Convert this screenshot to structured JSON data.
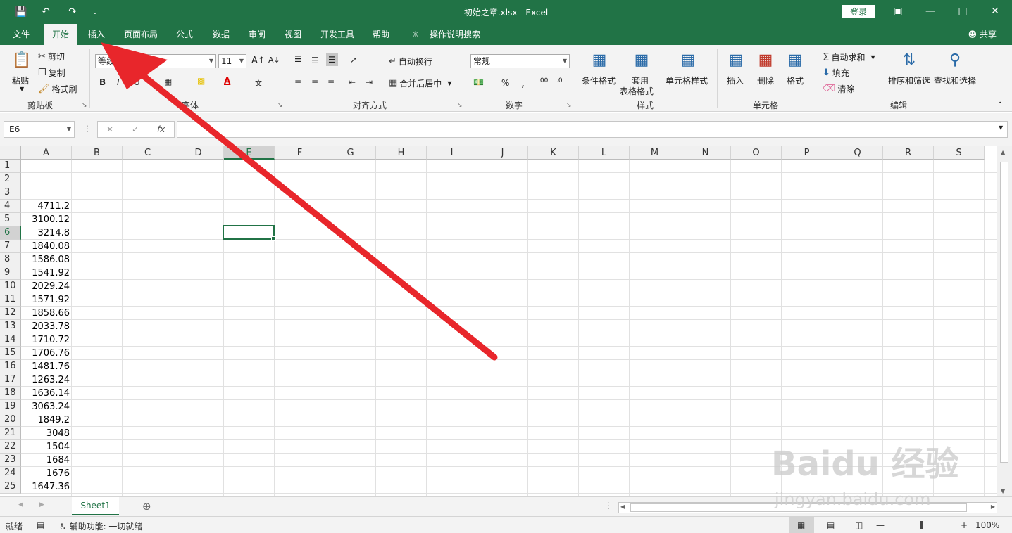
{
  "window": {
    "doc_title": "初始之章.xlsx  -  Excel",
    "login_label": "登录"
  },
  "tabs": [
    "文件",
    "开始",
    "插入",
    "页面布局",
    "公式",
    "数据",
    "审阅",
    "视图",
    "开发工具",
    "帮助",
    "操作说明搜索"
  ],
  "share_label": "共享",
  "ribbon": {
    "clipboard": {
      "paste": "粘贴",
      "cut": "剪切",
      "copy": "复制",
      "format_painter": "格式刷",
      "label": "剪贴板"
    },
    "font": {
      "name": "等线",
      "size": "11",
      "label": "字体",
      "bold": "B",
      "italic": "I",
      "underline": "U"
    },
    "alignment": {
      "wrap": "自动换行",
      "merge": "合并后居中",
      "label": "对齐方式"
    },
    "number": {
      "format": "常规",
      "percent": "%",
      "comma": ",",
      "label": "数字"
    },
    "styles": {
      "conditional": "条件格式",
      "table1": "套用",
      "table2": "表格格式",
      "cell_styles": "单元格样式",
      "label": "样式"
    },
    "cells": {
      "insert": "插入",
      "delete": "删除",
      "format": "格式",
      "label": "单元格"
    },
    "editing": {
      "autosum": "自动求和",
      "fill": "填充",
      "clear": "清除",
      "sort": "排序和筛选",
      "find": "查找和选择",
      "label": "编辑"
    }
  },
  "formula_bar": {
    "name_box": "E6",
    "fx": "fx",
    "value": ""
  },
  "columns": [
    "A",
    "B",
    "C",
    "D",
    "E",
    "F",
    "G",
    "H",
    "I",
    "J",
    "K",
    "L",
    "M",
    "N",
    "O",
    "P",
    "Q",
    "R",
    "S"
  ],
  "selected_column": "E",
  "selected_row": 6,
  "rows": [
    {
      "n": "1",
      "a": ""
    },
    {
      "n": "2",
      "a": ""
    },
    {
      "n": "3",
      "a": ""
    },
    {
      "n": "4",
      "a": "4711.2"
    },
    {
      "n": "5",
      "a": "3100.12"
    },
    {
      "n": "6",
      "a": "3214.8"
    },
    {
      "n": "7",
      "a": "1840.08"
    },
    {
      "n": "8",
      "a": "1586.08"
    },
    {
      "n": "9",
      "a": "1541.92"
    },
    {
      "n": "10",
      "a": "2029.24"
    },
    {
      "n": "11",
      "a": "1571.92"
    },
    {
      "n": "12",
      "a": "1858.66"
    },
    {
      "n": "13",
      "a": "2033.78"
    },
    {
      "n": "14",
      "a": "1710.72"
    },
    {
      "n": "15",
      "a": "1706.76"
    },
    {
      "n": "16",
      "a": "1481.76"
    },
    {
      "n": "17",
      "a": "1263.24"
    },
    {
      "n": "18",
      "a": "1636.14"
    },
    {
      "n": "19",
      "a": "3063.24"
    },
    {
      "n": "20",
      "a": "1849.2"
    },
    {
      "n": "21",
      "a": "3048"
    },
    {
      "n": "22",
      "a": "1504"
    },
    {
      "n": "23",
      "a": "1684"
    },
    {
      "n": "24",
      "a": "1676"
    },
    {
      "n": "25",
      "a": "1647.36"
    }
  ],
  "sheet_tab": "Sheet1",
  "status": {
    "ready": "就绪",
    "accessibility": "辅助功能: 一切就绪",
    "zoom": "100%"
  },
  "watermark": {
    "logo": "Baidu 经验",
    "url": "jingyan.baidu.com"
  },
  "colors": {
    "excel_green": "#217346",
    "arrow_red": "#e8262b"
  }
}
